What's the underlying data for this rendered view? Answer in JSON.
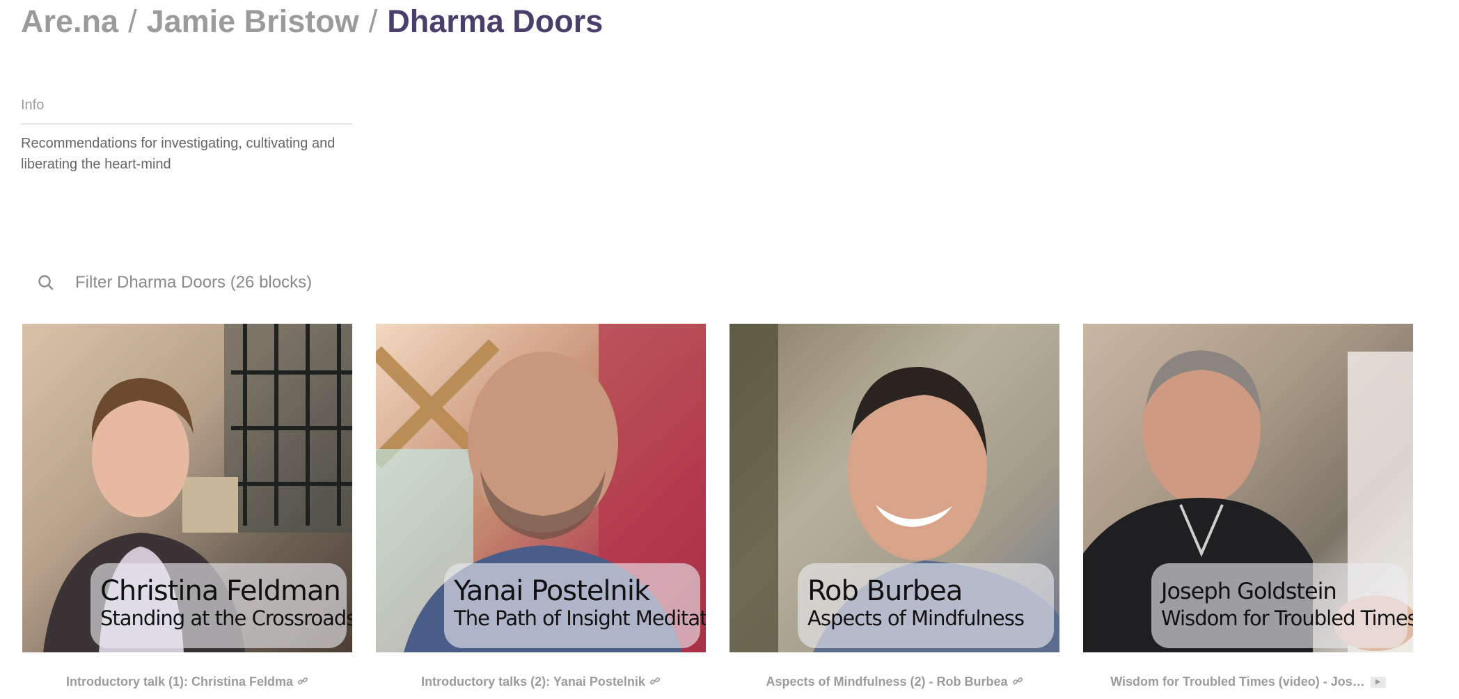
{
  "breadcrumb": {
    "site": "Are.na",
    "separator": "/",
    "user": "Jamie Bristow",
    "channel": "Dharma Doors"
  },
  "info": {
    "label": "Info",
    "description": "Recommendations for investigating, cultivating and liberating the heart-mind"
  },
  "filter": {
    "placeholder": "Filter Dharma Doors (26 blocks)",
    "icon": "search-icon"
  },
  "blocks": [
    {
      "overlay_name": "Christina Feldman",
      "overlay_subtitle": "Standing at the Crossroads",
      "caption": "Introductory talk (1): Christina Feldma",
      "type_icon": "link-icon"
    },
    {
      "overlay_name": "Yanai Postelnik",
      "overlay_subtitle": "The Path of Insight Meditation",
      "caption": "Introductory talks (2): Yanai Postelnik",
      "type_icon": "link-icon"
    },
    {
      "overlay_name": "Rob Burbea",
      "overlay_subtitle": "Aspects of Mindfulness",
      "caption": "Aspects of Mindfulness (2) - Rob Burbea",
      "type_icon": "link-icon"
    },
    {
      "overlay_name": "Joseph Goldstein",
      "overlay_subtitle": "Wisdom for Troubled Times",
      "caption": "Wisdom for Troubled Times (video) - Jos…",
      "type_icon": "play-icon",
      "badge": "▶"
    }
  ],
  "colors": {
    "muted": "#9b9b9b",
    "accent": "#4a3f6b",
    "divider": "#e6e6e6"
  }
}
